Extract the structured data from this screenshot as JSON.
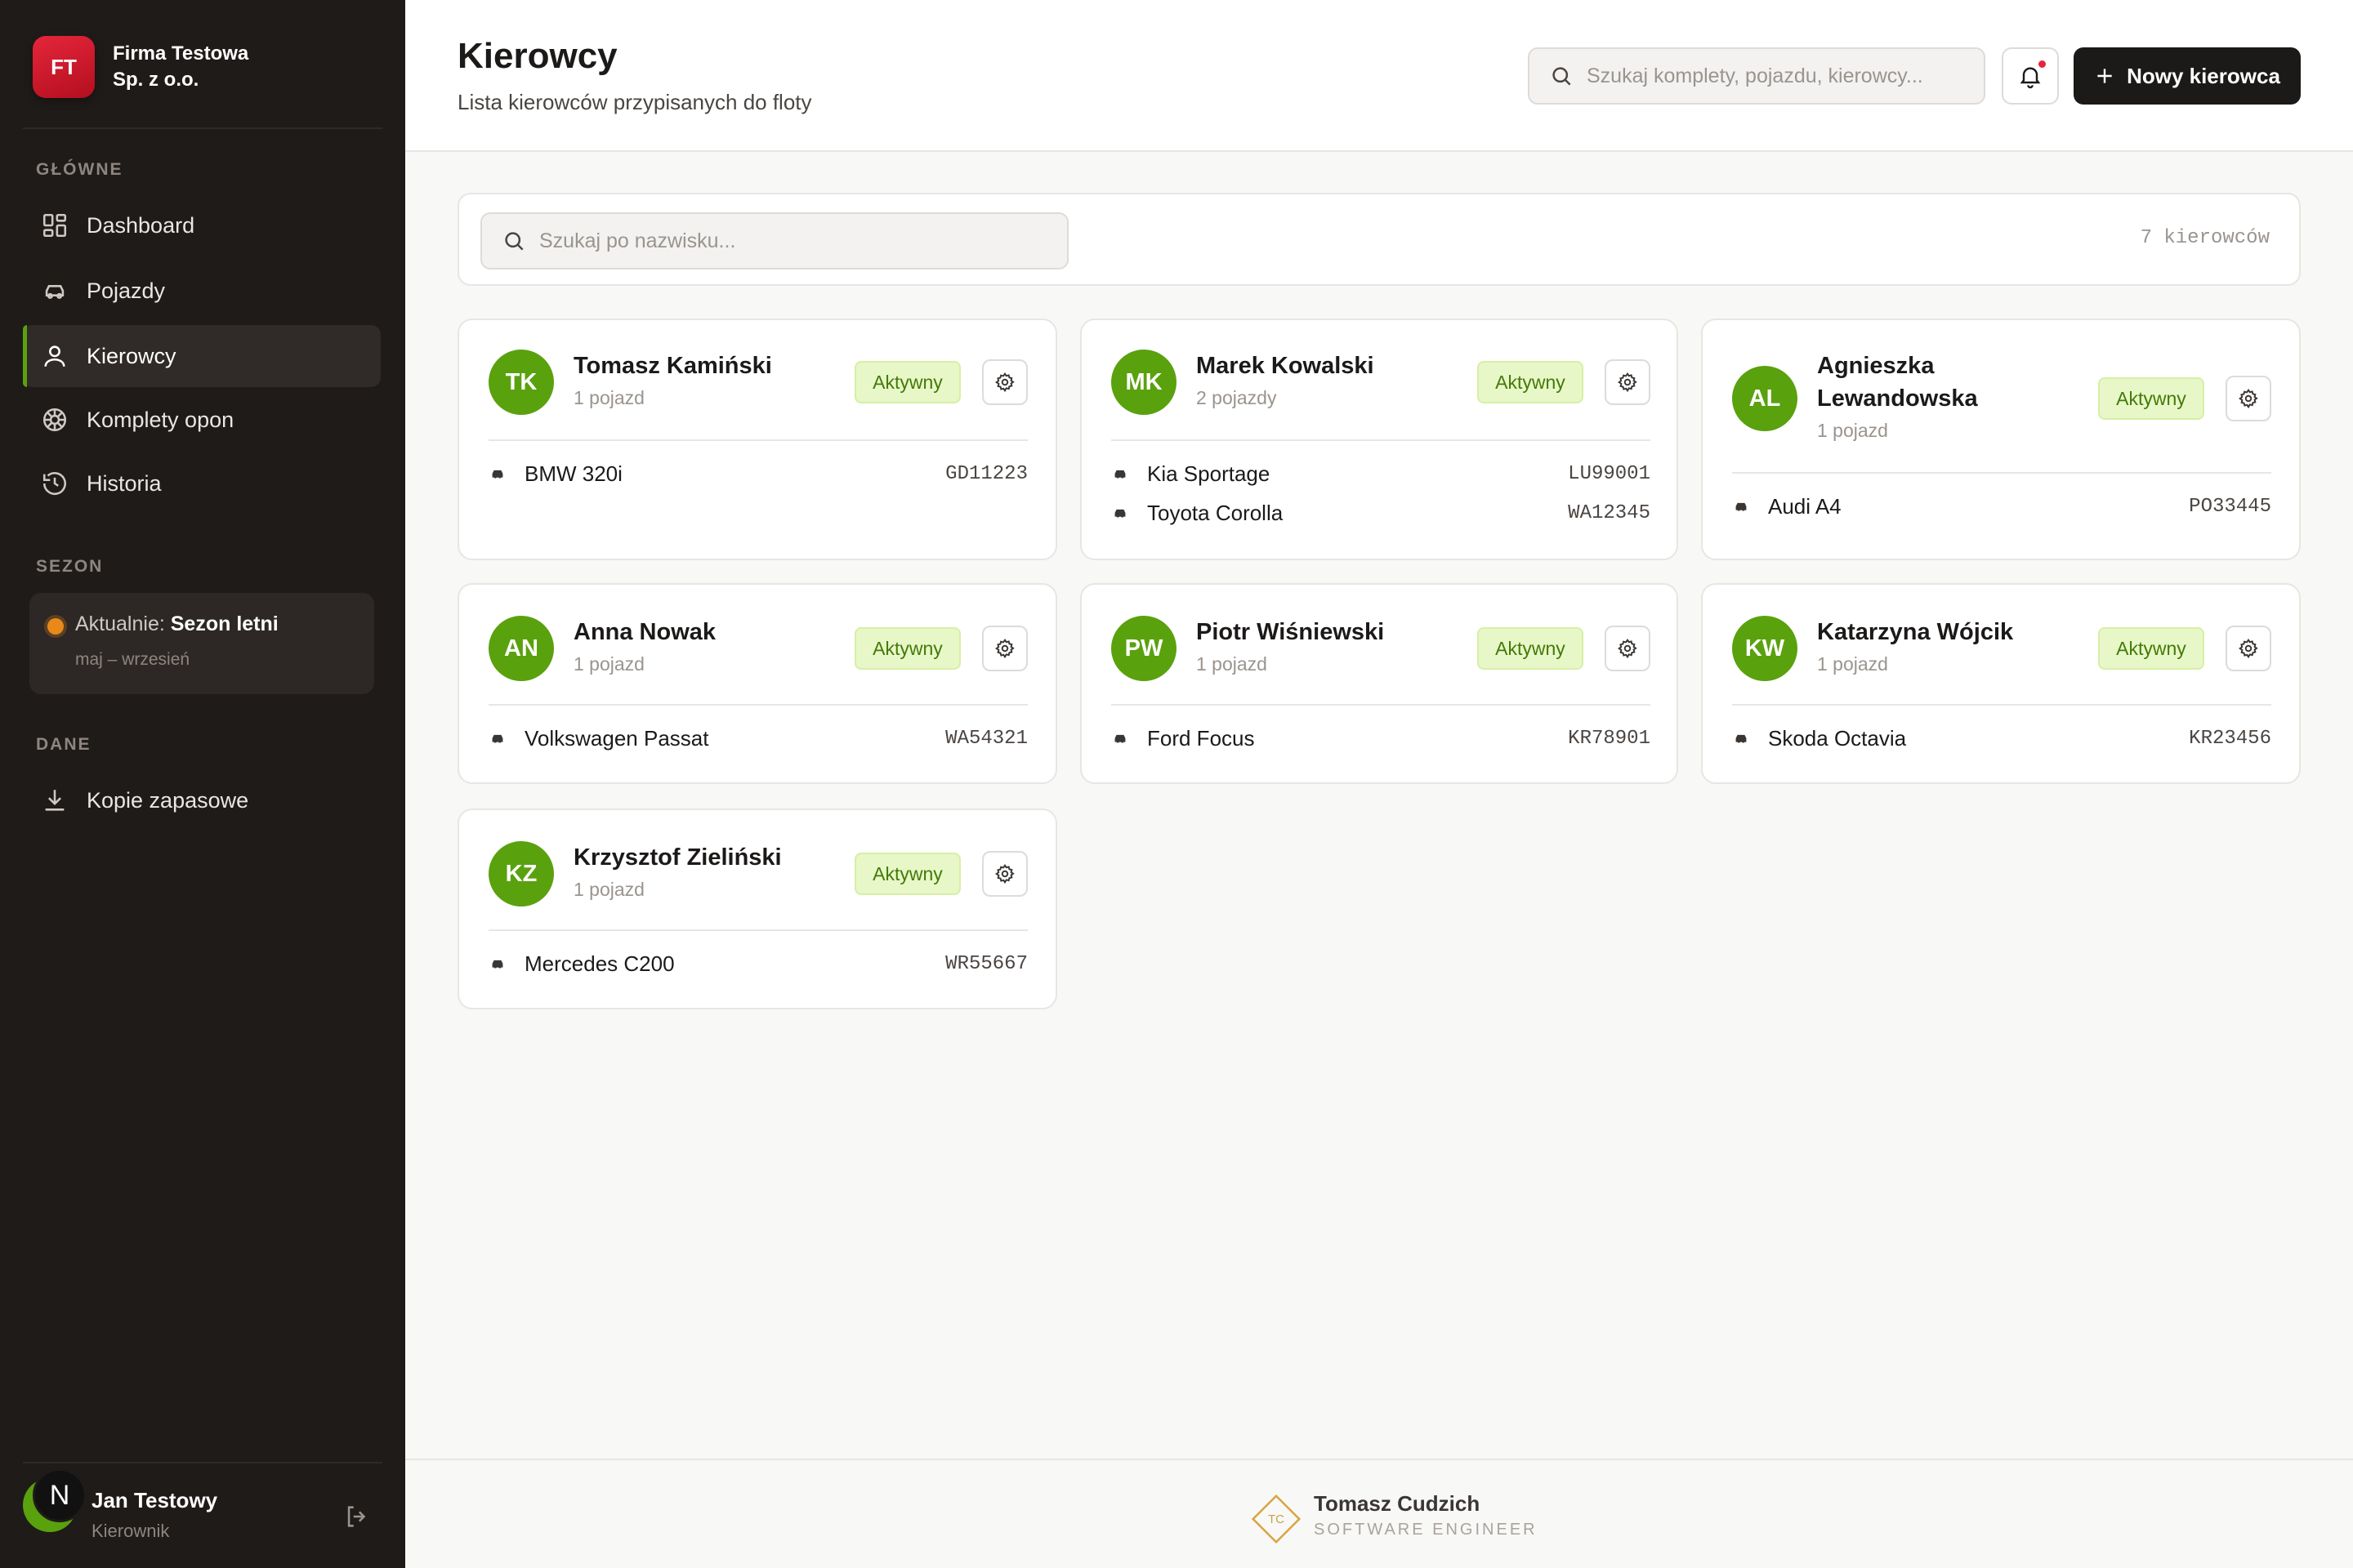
{
  "company": {
    "initials": "FT",
    "name": "Firma Testowa Sp. z o.o."
  },
  "sidebar": {
    "section_main": "GŁÓWNE",
    "items": [
      {
        "label": "Dashboard",
        "icon": "dashboard-icon"
      },
      {
        "label": "Pojazdy",
        "icon": "car-icon"
      },
      {
        "label": "Kierowcy",
        "icon": "user-icon",
        "active": true
      },
      {
        "label": "Komplety opon",
        "icon": "tire-icon"
      },
      {
        "label": "Historia",
        "icon": "history-icon"
      }
    ],
    "section_season": "SEZON",
    "season": {
      "prefix": "Aktualnie:",
      "name": "Sezon letni",
      "range": "maj – wrzesień"
    },
    "section_data": "DANE",
    "backup_label": "Kopie zapasowe"
  },
  "user": {
    "initial": "N",
    "name": "Jan Testowy",
    "role": "Kierownik"
  },
  "header": {
    "title": "Kierowcy",
    "subtitle": "Lista kierowców przypisanych do floty",
    "search_placeholder": "Szukaj komplety, pojazdu, kierowcy...",
    "new_button": "Nowy kierowca"
  },
  "filter": {
    "placeholder": "Szukaj po nazwisku...",
    "count": "7 kierowców"
  },
  "status_label": "Aktywny",
  "drivers": [
    {
      "initials": "TK",
      "name": "Tomasz Kamiński",
      "count": "1 pojazd",
      "vehicles": [
        {
          "name": "BMW 320i",
          "plate": "GD11223"
        }
      ]
    },
    {
      "initials": "MK",
      "name": "Marek Kowalski",
      "count": "2 pojazdy",
      "vehicles": [
        {
          "name": "Kia Sportage",
          "plate": "LU99001"
        },
        {
          "name": "Toyota Corolla",
          "plate": "WA12345"
        }
      ]
    },
    {
      "initials": "AL",
      "name_line1": "Agnieszka",
      "name_line2": "Lewandowska",
      "count": "1 pojazd",
      "vehicles": [
        {
          "name": "Audi A4",
          "plate": "PO33445"
        }
      ]
    },
    {
      "initials": "AN",
      "name": "Anna Nowak",
      "count": "1 pojazd",
      "vehicles": [
        {
          "name": "Volkswagen Passat",
          "plate": "WA54321"
        }
      ]
    },
    {
      "initials": "PW",
      "name": "Piotr Wiśniewski",
      "count": "1 pojazd",
      "vehicles": [
        {
          "name": "Ford Focus",
          "plate": "KR78901"
        }
      ]
    },
    {
      "initials": "KW",
      "name": "Katarzyna Wójcik",
      "count": "1 pojazd",
      "vehicles": [
        {
          "name": "Skoda Octavia",
          "plate": "KR23456"
        }
      ]
    },
    {
      "initials": "KZ",
      "name": "Krzysztof Zieliński",
      "count": "1 pojazd",
      "vehicles": [
        {
          "name": "Mercedes C200",
          "plate": "WR55667"
        }
      ]
    }
  ],
  "footer": {
    "logo_initials": "TC",
    "name": "Tomasz Cudzich",
    "role": "SOFTWARE ENGINEER"
  },
  "colors": {
    "accent_green": "#5aa10e",
    "brand_red": "#d81b2e",
    "sidebar_bg": "#1f1b19",
    "season_dot": "#e8891a"
  }
}
